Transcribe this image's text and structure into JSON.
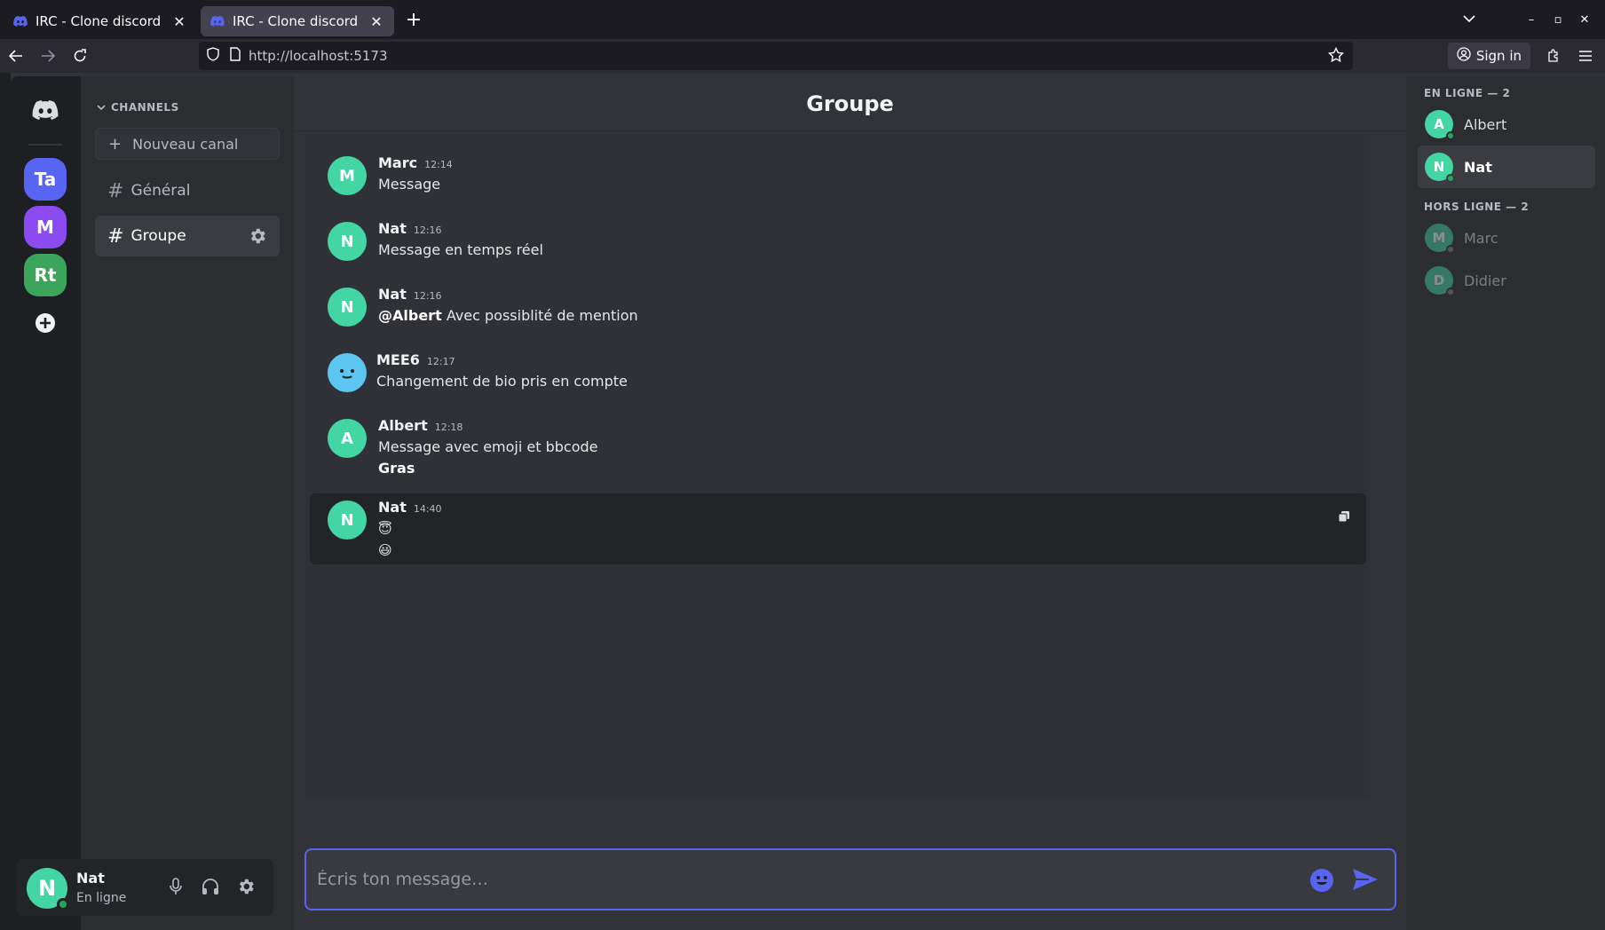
{
  "browser": {
    "tabs": [
      {
        "title": "IRC - Clone discord",
        "active": false
      },
      {
        "title": "IRC - Clone discord",
        "active": true
      }
    ],
    "url": "http://localhost:5173",
    "sign_in": "Sign in"
  },
  "servers": [
    {
      "label": "Ta",
      "color": "#5865f2"
    },
    {
      "label": "M",
      "color": "#8c4bf0"
    },
    {
      "label": "Rt",
      "color": "#3ba55c"
    }
  ],
  "sidebar": {
    "category": "CHANNELS",
    "new_channel": "Nouveau canal",
    "channels": [
      {
        "name": "Général",
        "active": false
      },
      {
        "name": "Groupe",
        "active": true
      }
    ]
  },
  "user_panel": {
    "initial": "N",
    "name": "Nat",
    "status": "En ligne"
  },
  "channel": {
    "title": "Groupe"
  },
  "messages": [
    {
      "initial": "M",
      "author": "Marc",
      "time": "12:14",
      "lines": [
        "Message"
      ]
    },
    {
      "initial": "N",
      "author": "Nat",
      "time": "12:16",
      "lines": [
        "Message en temps réel"
      ]
    },
    {
      "initial": "N",
      "author": "Nat",
      "time": "12:16",
      "mention": "@Albert",
      "lines": [
        "Avec possiblité de mention"
      ]
    },
    {
      "initial": "",
      "author": "MEE6",
      "time": "12:17",
      "lines": [
        "Changement de bio pris en compte"
      ]
    },
    {
      "initial": "A",
      "author": "Albert",
      "time": "12:18",
      "lines": [
        "Message avec emoji et bbcode",
        "Gras"
      ]
    },
    {
      "initial": "N",
      "author": "Nat",
      "time": "14:40",
      "lines": [
        "😇",
        "😃"
      ]
    }
  ],
  "composer": {
    "placeholder": "Écris ton message…"
  },
  "members": {
    "online_header": "EN LIGNE — 2",
    "offline_header": "HORS LIGNE — 2",
    "online": [
      {
        "initial": "A",
        "name": "Albert"
      },
      {
        "initial": "N",
        "name": "Nat"
      }
    ],
    "offline": [
      {
        "initial": "M",
        "name": "Marc"
      },
      {
        "initial": "D",
        "name": "Didier"
      }
    ]
  },
  "colors": {
    "accent": "#5865f2",
    "avatar": "#43d6a4",
    "online": "#23a55a",
    "offline": "#80848e"
  }
}
